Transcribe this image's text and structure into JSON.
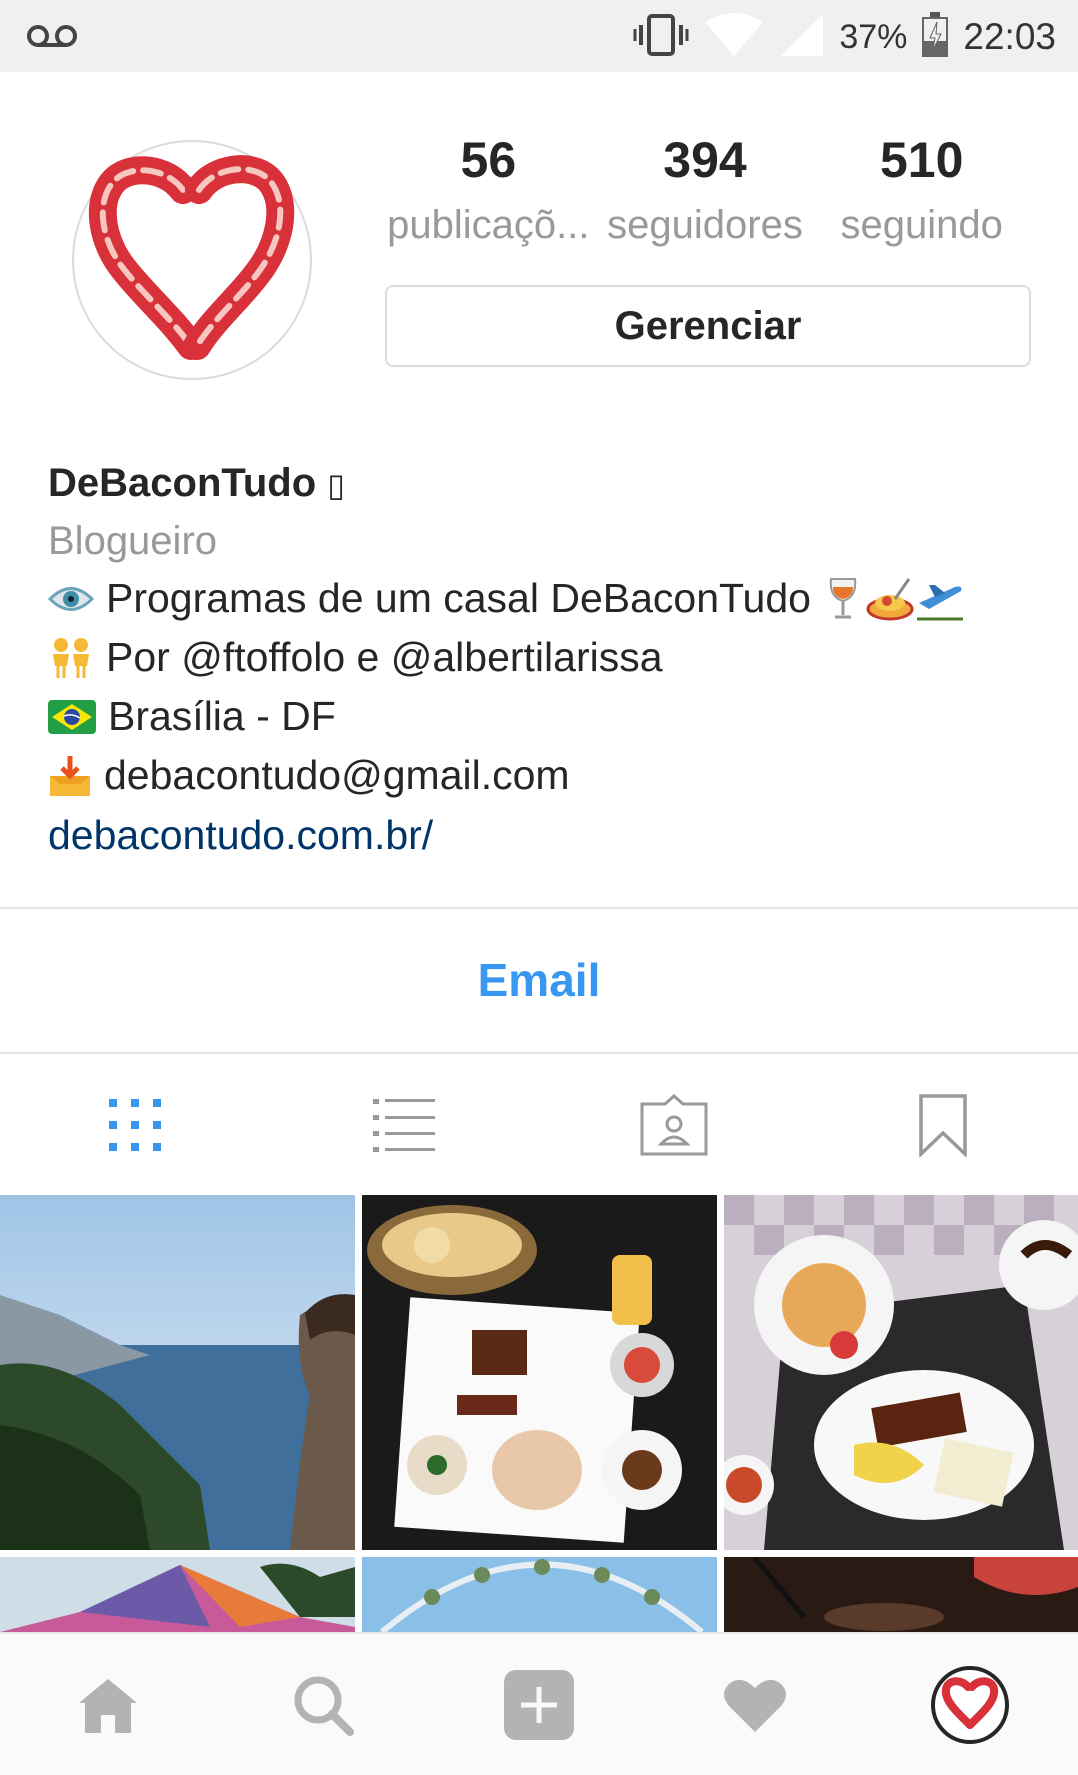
{
  "status_bar": {
    "voicemail_icon": "voicemail-icon",
    "battery_percent": "37%",
    "time": "22:03"
  },
  "profile": {
    "stats": [
      {
        "value": "56",
        "label": "publicaçõ..."
      },
      {
        "value": "394",
        "label": "seguidores"
      },
      {
        "value": "510",
        "label": "seguindo"
      }
    ],
    "manage_label": "Gerenciar",
    "name": "DeBaconTudo",
    "name_suffix": "▯",
    "category": "Blogueiro",
    "bio_lines": [
      "Programas de um casal DeBaconTudo",
      "Por @ftoffolo e @albertilarissa",
      "Brasília - DF",
      "debacontudo@gmail.com"
    ],
    "website": "debacontudo.com.br/",
    "email_button": "Email"
  },
  "colors": {
    "accent_blue": "#3897f0",
    "link_blue": "#003569",
    "bacon_red": "#d9313a"
  }
}
